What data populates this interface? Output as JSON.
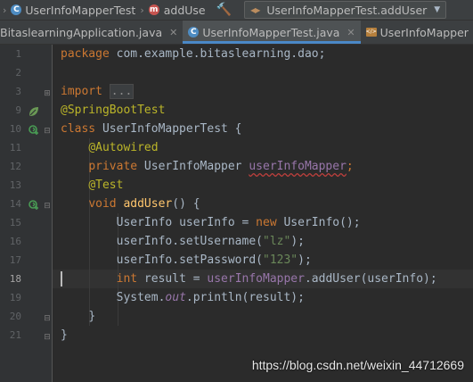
{
  "navbar": {
    "class_name": "UserInfoMapperTest",
    "method_name": "addUse",
    "run_config": "UserInfoMapperTest.addUser"
  },
  "tabs": [
    {
      "label": "BitaslearningApplication.java",
      "active": false
    },
    {
      "label": "UserInfoMapperTest.java",
      "active": true
    },
    {
      "label": "UserInfoMapper",
      "active": false
    }
  ],
  "gutter": {
    "line_numbers": [
      "1",
      "2",
      "3",
      "9",
      "10",
      "11",
      "12",
      "13",
      "14",
      "15",
      "16",
      "17",
      "18",
      "19",
      "20",
      "21"
    ],
    "current_line": "18"
  },
  "code": {
    "l1_kw": "package",
    "l1_rest": " com.example.bitaslearning.dao;",
    "l3_kw": "import",
    "l3_fold": "...",
    "l9_ann": "@SpringBootTest",
    "l10_kw": "class",
    "l10_rest": " UserInfoMapperTest {",
    "l11_ann": "@Autowired",
    "l12_kw": "private",
    "l12_type": " UserInfoMapper ",
    "l12_field": "userInfoMapper",
    "l12_semi": ";",
    "l13_ann": "@Test",
    "l14_kw": "void",
    "l14_name": "addUser",
    "l14_rest": "() {",
    "l15_a": "UserInfo userInfo = ",
    "l15_kw": "new",
    "l15_b": " UserInfo();",
    "l16_a": "userInfo.setUsername(",
    "l16_str": "\"lz\"",
    "l16_b": ");",
    "l17_a": "userInfo.setPassword(",
    "l17_str": "\"123\"",
    "l17_b": ");",
    "l18_kw": "int",
    "l18_a": " result = ",
    "l18_field": "userInfoMapper",
    "l18_b": ".addUser(userInfo);",
    "l19_a": "System.",
    "l19_out": "out",
    "l19_b": ".println(result);",
    "l20": "}",
    "l21": "}"
  },
  "watermark": "https://blog.csdn.net/weixin_44712669"
}
